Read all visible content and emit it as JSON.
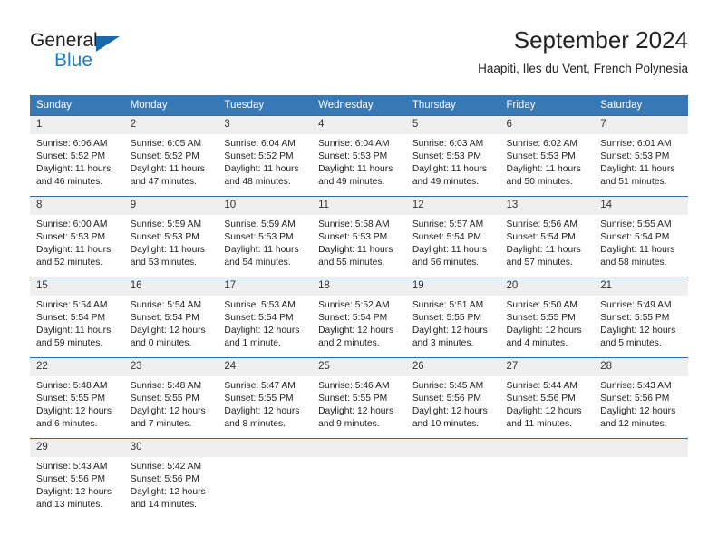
{
  "logo": {
    "text_general": "General",
    "text_blue": "Blue",
    "accent_color": "#1f7dc4",
    "triangle_color": "#1769aa"
  },
  "header": {
    "title": "September 2024",
    "subtitle": "Haapiti, Iles du Vent, French Polynesia"
  },
  "theme": {
    "header_row_bg": "#3778b5",
    "daynum_bg": "#efefef",
    "cell_border": "#2c6ca8"
  },
  "weekdays": [
    "Sunday",
    "Monday",
    "Tuesday",
    "Wednesday",
    "Thursday",
    "Friday",
    "Saturday"
  ],
  "weeks": [
    [
      {
        "day": "1",
        "sunrise": "Sunrise: 6:06 AM",
        "sunset": "Sunset: 5:52 PM",
        "daylight1": "Daylight: 11 hours",
        "daylight2": "and 46 minutes."
      },
      {
        "day": "2",
        "sunrise": "Sunrise: 6:05 AM",
        "sunset": "Sunset: 5:52 PM",
        "daylight1": "Daylight: 11 hours",
        "daylight2": "and 47 minutes."
      },
      {
        "day": "3",
        "sunrise": "Sunrise: 6:04 AM",
        "sunset": "Sunset: 5:52 PM",
        "daylight1": "Daylight: 11 hours",
        "daylight2": "and 48 minutes."
      },
      {
        "day": "4",
        "sunrise": "Sunrise: 6:04 AM",
        "sunset": "Sunset: 5:53 PM",
        "daylight1": "Daylight: 11 hours",
        "daylight2": "and 49 minutes."
      },
      {
        "day": "5",
        "sunrise": "Sunrise: 6:03 AM",
        "sunset": "Sunset: 5:53 PM",
        "daylight1": "Daylight: 11 hours",
        "daylight2": "and 49 minutes."
      },
      {
        "day": "6",
        "sunrise": "Sunrise: 6:02 AM",
        "sunset": "Sunset: 5:53 PM",
        "daylight1": "Daylight: 11 hours",
        "daylight2": "and 50 minutes."
      },
      {
        "day": "7",
        "sunrise": "Sunrise: 6:01 AM",
        "sunset": "Sunset: 5:53 PM",
        "daylight1": "Daylight: 11 hours",
        "daylight2": "and 51 minutes."
      }
    ],
    [
      {
        "day": "8",
        "sunrise": "Sunrise: 6:00 AM",
        "sunset": "Sunset: 5:53 PM",
        "daylight1": "Daylight: 11 hours",
        "daylight2": "and 52 minutes."
      },
      {
        "day": "9",
        "sunrise": "Sunrise: 5:59 AM",
        "sunset": "Sunset: 5:53 PM",
        "daylight1": "Daylight: 11 hours",
        "daylight2": "and 53 minutes."
      },
      {
        "day": "10",
        "sunrise": "Sunrise: 5:59 AM",
        "sunset": "Sunset: 5:53 PM",
        "daylight1": "Daylight: 11 hours",
        "daylight2": "and 54 minutes."
      },
      {
        "day": "11",
        "sunrise": "Sunrise: 5:58 AM",
        "sunset": "Sunset: 5:53 PM",
        "daylight1": "Daylight: 11 hours",
        "daylight2": "and 55 minutes."
      },
      {
        "day": "12",
        "sunrise": "Sunrise: 5:57 AM",
        "sunset": "Sunset: 5:54 PM",
        "daylight1": "Daylight: 11 hours",
        "daylight2": "and 56 minutes."
      },
      {
        "day": "13",
        "sunrise": "Sunrise: 5:56 AM",
        "sunset": "Sunset: 5:54 PM",
        "daylight1": "Daylight: 11 hours",
        "daylight2": "and 57 minutes."
      },
      {
        "day": "14",
        "sunrise": "Sunrise: 5:55 AM",
        "sunset": "Sunset: 5:54 PM",
        "daylight1": "Daylight: 11 hours",
        "daylight2": "and 58 minutes."
      }
    ],
    [
      {
        "day": "15",
        "sunrise": "Sunrise: 5:54 AM",
        "sunset": "Sunset: 5:54 PM",
        "daylight1": "Daylight: 11 hours",
        "daylight2": "and 59 minutes."
      },
      {
        "day": "16",
        "sunrise": "Sunrise: 5:54 AM",
        "sunset": "Sunset: 5:54 PM",
        "daylight1": "Daylight: 12 hours",
        "daylight2": "and 0 minutes."
      },
      {
        "day": "17",
        "sunrise": "Sunrise: 5:53 AM",
        "sunset": "Sunset: 5:54 PM",
        "daylight1": "Daylight: 12 hours",
        "daylight2": "and 1 minute."
      },
      {
        "day": "18",
        "sunrise": "Sunrise: 5:52 AM",
        "sunset": "Sunset: 5:54 PM",
        "daylight1": "Daylight: 12 hours",
        "daylight2": "and 2 minutes."
      },
      {
        "day": "19",
        "sunrise": "Sunrise: 5:51 AM",
        "sunset": "Sunset: 5:55 PM",
        "daylight1": "Daylight: 12 hours",
        "daylight2": "and 3 minutes."
      },
      {
        "day": "20",
        "sunrise": "Sunrise: 5:50 AM",
        "sunset": "Sunset: 5:55 PM",
        "daylight1": "Daylight: 12 hours",
        "daylight2": "and 4 minutes."
      },
      {
        "day": "21",
        "sunrise": "Sunrise: 5:49 AM",
        "sunset": "Sunset: 5:55 PM",
        "daylight1": "Daylight: 12 hours",
        "daylight2": "and 5 minutes."
      }
    ],
    [
      {
        "day": "22",
        "sunrise": "Sunrise: 5:48 AM",
        "sunset": "Sunset: 5:55 PM",
        "daylight1": "Daylight: 12 hours",
        "daylight2": "and 6 minutes."
      },
      {
        "day": "23",
        "sunrise": "Sunrise: 5:48 AM",
        "sunset": "Sunset: 5:55 PM",
        "daylight1": "Daylight: 12 hours",
        "daylight2": "and 7 minutes."
      },
      {
        "day": "24",
        "sunrise": "Sunrise: 5:47 AM",
        "sunset": "Sunset: 5:55 PM",
        "daylight1": "Daylight: 12 hours",
        "daylight2": "and 8 minutes."
      },
      {
        "day": "25",
        "sunrise": "Sunrise: 5:46 AM",
        "sunset": "Sunset: 5:55 PM",
        "daylight1": "Daylight: 12 hours",
        "daylight2": "and 9 minutes."
      },
      {
        "day": "26",
        "sunrise": "Sunrise: 5:45 AM",
        "sunset": "Sunset: 5:56 PM",
        "daylight1": "Daylight: 12 hours",
        "daylight2": "and 10 minutes."
      },
      {
        "day": "27",
        "sunrise": "Sunrise: 5:44 AM",
        "sunset": "Sunset: 5:56 PM",
        "daylight1": "Daylight: 12 hours",
        "daylight2": "and 11 minutes."
      },
      {
        "day": "28",
        "sunrise": "Sunrise: 5:43 AM",
        "sunset": "Sunset: 5:56 PM",
        "daylight1": "Daylight: 12 hours",
        "daylight2": "and 12 minutes."
      }
    ],
    [
      {
        "day": "29",
        "sunrise": "Sunrise: 5:43 AM",
        "sunset": "Sunset: 5:56 PM",
        "daylight1": "Daylight: 12 hours",
        "daylight2": "and 13 minutes."
      },
      {
        "day": "30",
        "sunrise": "Sunrise: 5:42 AM",
        "sunset": "Sunset: 5:56 PM",
        "daylight1": "Daylight: 12 hours",
        "daylight2": "and 14 minutes."
      },
      {
        "day": "",
        "sunrise": "",
        "sunset": "",
        "daylight1": "",
        "daylight2": "",
        "empty": true
      },
      {
        "day": "",
        "sunrise": "",
        "sunset": "",
        "daylight1": "",
        "daylight2": "",
        "empty": true
      },
      {
        "day": "",
        "sunrise": "",
        "sunset": "",
        "daylight1": "",
        "daylight2": "",
        "empty": true
      },
      {
        "day": "",
        "sunrise": "",
        "sunset": "",
        "daylight1": "",
        "daylight2": "",
        "empty": true
      },
      {
        "day": "",
        "sunrise": "",
        "sunset": "",
        "daylight1": "",
        "daylight2": "",
        "empty": true
      }
    ]
  ]
}
